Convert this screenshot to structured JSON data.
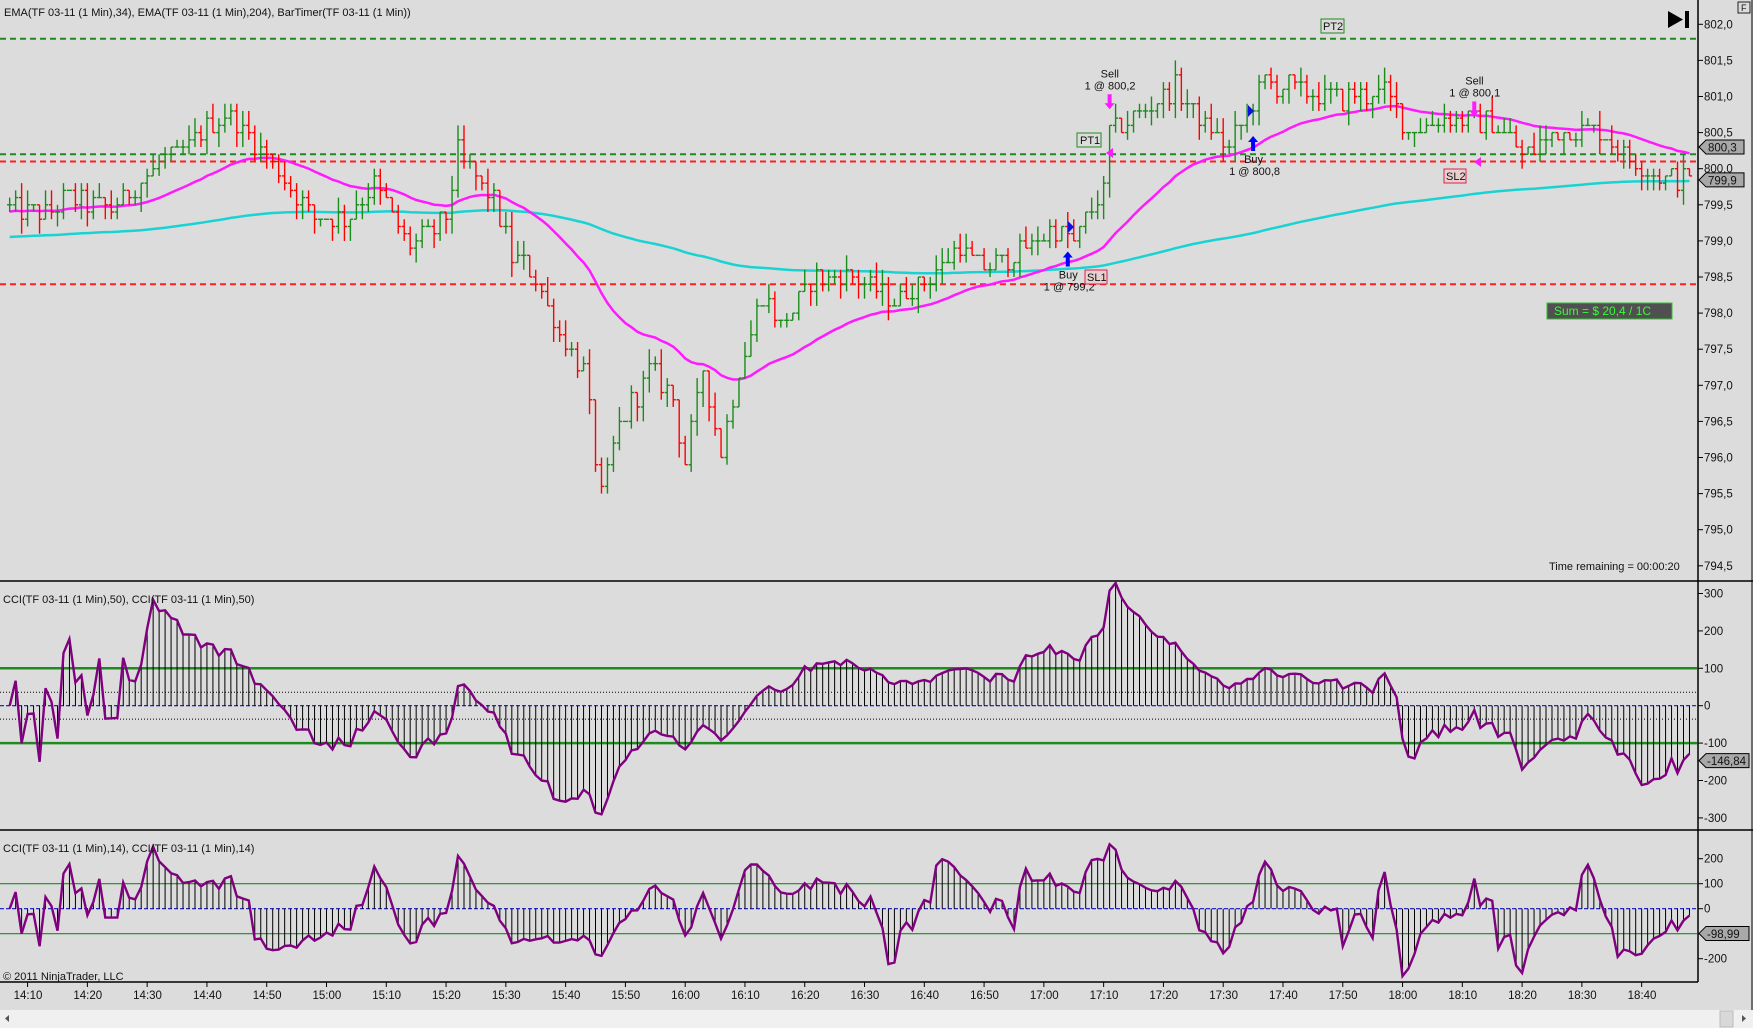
{
  "header": {
    "price_title": "EMA(TF 03-11 (1 Min),34), EMA(TF 03-11 (1 Min),204), BarTimer(TF 03-11 (1 Min))",
    "cci50_title": "CCI(TF 03-11 (1 Min),50), CCI(TF 03-11 (1 Min),50)",
    "cci14_title": "CCI(TF 03-11 (1 Min),14), CCI(TF 03-11 (1 Min),14)",
    "copyright": "© 2011 NinjaTrader, LLC",
    "f_button": "F",
    "time_remaining": "Time remaining = 00:00:20",
    "sum_label": "Sum = $ 20,4 / 1C"
  },
  "colors": {
    "up_bar": "#1a8c1a",
    "down_bar": "#ff0000",
    "ema34": "#ff1aff",
    "ema204": "#19d3d3",
    "cci_line": "#800080",
    "target_line": "#1f8a1f",
    "stop_line": "#ff2020"
  },
  "chart_data": [
    {
      "type": "ohlc",
      "title": "TF 03-11 (1 Min)",
      "time_start": "14:07",
      "time_end": "18:48",
      "price_path": [
        [
          "14:07",
          799.45
        ],
        [
          "14:13",
          799.35
        ],
        [
          "14:16",
          799.6
        ],
        [
          "14:24",
          799.45
        ],
        [
          "14:31",
          800.0
        ],
        [
          "14:37",
          800.3
        ],
        [
          "14:43",
          800.8
        ],
        [
          "14:50",
          800.2
        ],
        [
          "14:58",
          799.3
        ],
        [
          "15:03",
          799.3
        ],
        [
          "15:08",
          799.8
        ],
        [
          "15:14",
          798.9
        ],
        [
          "15:20",
          799.3
        ],
        [
          "15:22",
          800.2
        ],
        [
          "15:28",
          799.55
        ],
        [
          "15:31",
          798.8
        ],
        [
          "15:35",
          798.5
        ],
        [
          "15:39",
          797.7
        ],
        [
          "15:43",
          797.2
        ],
        [
          "15:46",
          795.45
        ],
        [
          "15:49",
          796.45
        ],
        [
          "15:54",
          797.2
        ],
        [
          "15:58",
          796.8
        ],
        [
          "16:00",
          795.9
        ],
        [
          "16:03",
          797.2
        ],
        [
          "16:06",
          796.1
        ],
        [
          "16:09",
          797.2
        ],
        [
          "16:13",
          798.3
        ],
        [
          "16:16",
          797.85
        ],
        [
          "16:22",
          798.5
        ],
        [
          "16:28",
          798.5
        ],
        [
          "16:35",
          798.15
        ],
        [
          "16:41",
          798.5
        ],
        [
          "16:46",
          798.9
        ],
        [
          "16:50",
          798.6
        ],
        [
          "16:57",
          798.9
        ],
        [
          "17:02",
          799.2
        ],
        [
          "17:05",
          799.0
        ],
        [
          "17:10",
          799.7
        ],
        [
          "17:11",
          800.5
        ],
        [
          "17:16",
          800.8
        ],
        [
          "17:22",
          801.1
        ],
        [
          "17:27",
          800.6
        ],
        [
          "17:31",
          800.3
        ],
        [
          "17:37",
          801.2
        ],
        [
          "17:42",
          801.1
        ],
        [
          "17:50",
          800.95
        ],
        [
          "17:57",
          801.1
        ],
        [
          "18:01",
          800.55
        ],
        [
          "18:09",
          800.7
        ],
        [
          "18:16",
          800.6
        ],
        [
          "18:20",
          800.2
        ],
        [
          "18:27",
          800.55
        ],
        [
          "18:33",
          800.5
        ],
        [
          "18:39",
          800.1
        ],
        [
          "18:44",
          799.85
        ],
        [
          "18:48",
          799.9
        ]
      ],
      "ema_fast": {
        "period": 34,
        "seed": 799.4
      },
      "ema_slow": {
        "period": 204,
        "seed": 799.05
      },
      "ylim": [
        794.5,
        802.0
      ],
      "y_ticks": [
        {
          "v": 802.0,
          "label": "802,0"
        },
        {
          "v": 801.5,
          "label": "801,5"
        },
        {
          "v": 801.0,
          "label": "801,0"
        },
        {
          "v": 800.5,
          "label": "800,5"
        },
        {
          "v": 800.0,
          "label": "800,0"
        },
        {
          "v": 799.5,
          "label": "799,5"
        },
        {
          "v": 799.0,
          "label": "799,0"
        },
        {
          "v": 798.5,
          "label": "798,5"
        },
        {
          "v": 798.0,
          "label": "798,0"
        },
        {
          "v": 797.5,
          "label": "797,5"
        },
        {
          "v": 797.0,
          "label": "797,0"
        },
        {
          "v": 796.5,
          "label": "796,5"
        },
        {
          "v": 796.0,
          "label": "796,0"
        },
        {
          "v": 795.5,
          "label": "795,5"
        },
        {
          "v": 795.0,
          "label": "795,0"
        },
        {
          "v": 794.5,
          "label": "794,5"
        }
      ],
      "levels": [
        {
          "name": "PT2",
          "price": 801.8,
          "kind": "target"
        },
        {
          "name": "PT1",
          "price": 800.2,
          "kind": "target"
        },
        {
          "name": "SL2",
          "price": 800.1,
          "kind": "stop"
        },
        {
          "name": "SL1",
          "price": 798.4,
          "kind": "stop"
        }
      ],
      "price_markers": [
        {
          "label": "800,3",
          "value": 800.3
        },
        {
          "label": "799,9",
          "value": 799.9
        }
      ],
      "trades": [
        {
          "side": "Buy",
          "fill": "1 @ 799,2",
          "time": "17:04",
          "price": 799.2
        },
        {
          "side": "Sell",
          "fill": "1 @ 800,2",
          "time": "17:11",
          "price": 800.2
        },
        {
          "side": "Buy",
          "fill": "1 @ 800,8",
          "time": "17:35",
          "price": 800.8
        },
        {
          "side": "Sell",
          "fill": "1 @ 800,1",
          "time": "18:12",
          "price": 800.1
        }
      ],
      "order_labels": [
        "PT1",
        "SL1",
        "PT2",
        "SL2"
      ]
    },
    {
      "type": "line+histogram",
      "title": "CCI 50",
      "period": 50,
      "ylim": [
        -330,
        330
      ],
      "y_ticks": [
        {
          "v": 300,
          "label": "300"
        },
        {
          "v": 200,
          "label": "200"
        },
        {
          "v": 100,
          "label": "100"
        },
        {
          "v": 0,
          "label": "0"
        },
        {
          "v": -100,
          "label": "-100"
        },
        {
          "v": -200,
          "label": "-200"
        },
        {
          "v": -300,
          "label": "-300"
        }
      ],
      "levels": [
        100,
        -100,
        36,
        -36
      ],
      "last_value": {
        "label": "-146,84",
        "value": -146.84
      }
    },
    {
      "type": "line+histogram",
      "title": "CCI 14",
      "period": 14,
      "ylim": [
        -295,
        295
      ],
      "y_ticks": [
        {
          "v": 200,
          "label": "200"
        },
        {
          "v": 100,
          "label": "100"
        },
        {
          "v": 0,
          "label": "0"
        },
        {
          "v": -100,
          "label": "-100"
        },
        {
          "v": -200,
          "label": "-200"
        }
      ],
      "levels": [
        100,
        -100
      ],
      "last_value": {
        "label": "-98,99",
        "value": -98.99
      }
    }
  ],
  "time_axis": [
    "14:10",
    "14:20",
    "14:30",
    "14:40",
    "14:50",
    "15:00",
    "15:10",
    "15:20",
    "15:30",
    "15:40",
    "15:50",
    "16:00",
    "16:10",
    "16:20",
    "16:30",
    "16:40",
    "16:50",
    "17:00",
    "17:10",
    "17:20",
    "17:30",
    "17:40",
    "17:50",
    "18:00",
    "18:10",
    "18:20",
    "18:30",
    "18:40"
  ]
}
